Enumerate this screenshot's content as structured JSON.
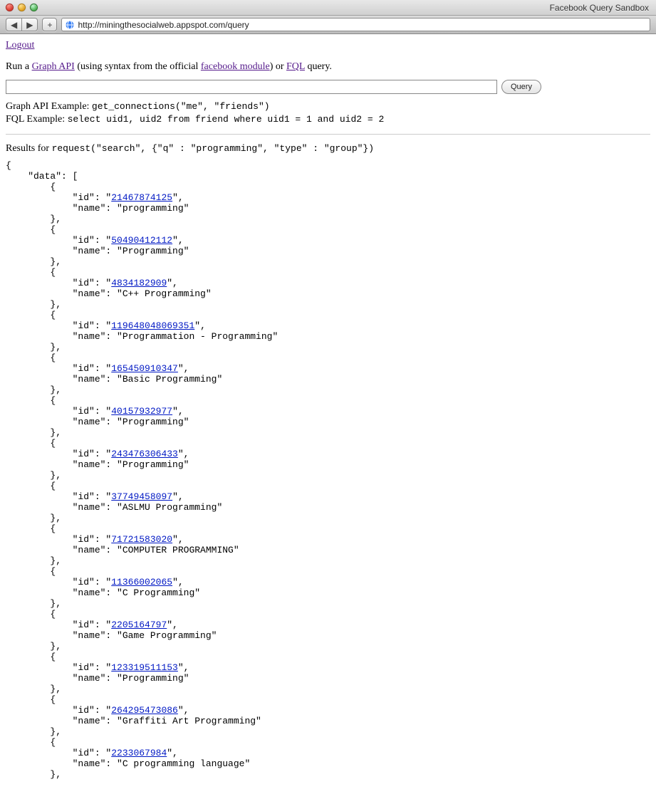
{
  "window": {
    "title": "Facebook Query Sandbox"
  },
  "toolbar": {
    "back": "◀",
    "forward": "▶",
    "add": "+",
    "url": "http://miningthesocialweb.appspot.com/query"
  },
  "page": {
    "logout": "Logout",
    "intro_prefix": "Run a ",
    "graph_api_link": "Graph API",
    "intro_mid1": " (using syntax from the official ",
    "fb_module_link": "facebook module",
    "intro_mid2": ") or ",
    "fql_link": "FQL",
    "intro_suffix": " query.",
    "query_button": "Query",
    "graph_example_label": "Graph API Example: ",
    "graph_example_code": "get_connections(\"me\", \"friends\")",
    "fql_example_label": "FQL Example: ",
    "fql_example_code": "select uid1, uid2 from friend where uid1 = 1 and uid2 = 2",
    "results_label": "Results for ",
    "results_code": "request(\"search\", {\"q\" : \"programming\", \"type\" : \"group\"})"
  },
  "results": {
    "data": [
      {
        "id": "21467874125",
        "name": "programming"
      },
      {
        "id": "50490412112",
        "name": "Programming"
      },
      {
        "id": "4834182909",
        "name": "C++ Programming"
      },
      {
        "id": "119648048069351",
        "name": "Programmation - Programming"
      },
      {
        "id": "165450910347",
        "name": "Basic Programming"
      },
      {
        "id": "40157932977",
        "name": "Programming"
      },
      {
        "id": "243476306433",
        "name": "Programming"
      },
      {
        "id": "37749458097",
        "name": "ASLMU Programming"
      },
      {
        "id": "71721583020",
        "name": "COMPUTER PROGRAMMING"
      },
      {
        "id": "11366002065",
        "name": "C Programming"
      },
      {
        "id": "2205164797",
        "name": "Game Programming"
      },
      {
        "id": "123319511153",
        "name": "Programming"
      },
      {
        "id": "264295473086",
        "name": "Graffiti Art Programming"
      },
      {
        "id": "2233067984",
        "name": "C programming language"
      }
    ]
  }
}
